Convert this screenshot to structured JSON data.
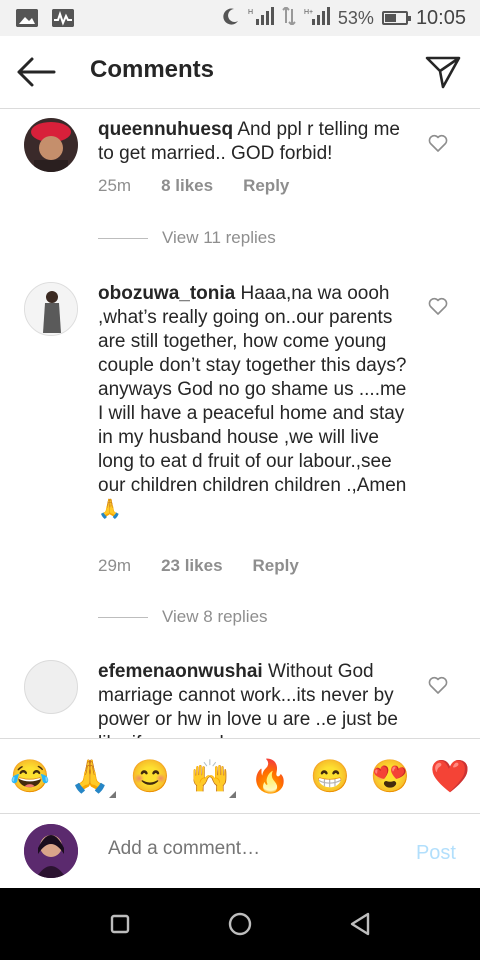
{
  "status_bar": {
    "battery_percent": "53%",
    "time": "10:05",
    "battery_level": 0.53
  },
  "header": {
    "title": "Comments"
  },
  "comments": [
    {
      "username": "queennuhuesq",
      "text": "And ppl r telling me to get married.. GOD forbid!",
      "time": "25m",
      "likes": "8 likes",
      "reply_label": "Reply",
      "view_replies": "View 11 replies"
    },
    {
      "username": "obozuwa_tonia",
      "text": "Haaa,na wa oooh ,what’s really going on..our parents are still together, how come young couple don’t stay together this days? anyways God no go shame us ....me I will have a peaceful home and stay in my husband house ,we will live long to eat d fruit of our labour.,see our children children children .,Amen 🙏",
      "time": "29m",
      "likes": "23 likes",
      "reply_label": "Reply",
      "view_replies": "View 8 replies"
    },
    {
      "username": "efemenaonwushai",
      "text": "Without God marriage cannot work...its never by power or hw in love u are ..e just be like if e go work..."
    }
  ],
  "emoji_bar": [
    "😂",
    "🙏",
    "😊",
    "🙌",
    "🔥",
    "😁",
    "😍",
    "❤️"
  ],
  "comment_input": {
    "placeholder": "Add a comment…",
    "post_label": "Post"
  },
  "colors": {
    "text": "#262626",
    "secondary_text": "#8e8e8e",
    "post_disabled": "#b2dffc",
    "divider": "#dbdbdb"
  }
}
